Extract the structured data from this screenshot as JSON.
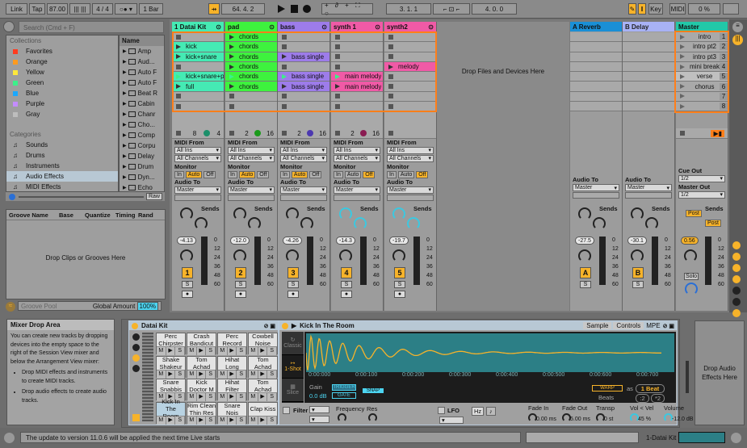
{
  "toolbar": {
    "link": "Link",
    "tap": "Tap",
    "tempo": "87.00",
    "signature": "4 / 4",
    "quantize": "1 Bar",
    "position": "64.  4.  2",
    "loop_start": "3.  1.  1",
    "loop_length": "4.  0.  0",
    "key": "Key",
    "midi": "MIDI",
    "cpu": "0 %"
  },
  "browser": {
    "search_placeholder": "Search (Cmd + F)",
    "collections_label": "Collections",
    "collections": [
      {
        "label": "Favorites",
        "color": "#ff3b1f"
      },
      {
        "label": "Orange",
        "color": "#ff9a1f"
      },
      {
        "label": "Yellow",
        "color": "#ffe83a"
      },
      {
        "label": "Green",
        "color": "#3cf08a"
      },
      {
        "label": "Blue",
        "color": "#1aa8ff"
      },
      {
        "label": "Purple",
        "color": "#c48cff"
      },
      {
        "label": "Gray",
        "color": "#bdbdbd"
      }
    ],
    "categories_label": "Categories",
    "categories": [
      {
        "label": "Sounds",
        "icon": "note-icon"
      },
      {
        "label": "Drums",
        "icon": "drums-icon"
      },
      {
        "label": "Instruments",
        "icon": "instrument-icon"
      },
      {
        "label": "Audio Effects",
        "icon": "audio-effects-icon",
        "selected": true
      },
      {
        "label": "MIDI Effects",
        "icon": "midi-effects-icon"
      }
    ],
    "name_header": "Name",
    "items": [
      "Amp",
      "Aud...",
      "Auto F",
      "Auto F",
      "Beat R",
      "Cabin",
      "Chanr",
      "Cho...",
      "Comp",
      "Corpu",
      "Delay",
      "Drum",
      "Dyn...",
      "Echo"
    ],
    "raw": "Raw"
  },
  "groove": {
    "columns": [
      "Groove Name",
      "Base",
      "Quantize",
      "Timing",
      "Rand"
    ],
    "empty": "Drop Clips or Grooves Here",
    "title": "Groove Pool",
    "global_amount_label": "Global Amount",
    "global_amount": "100%"
  },
  "tracks": [
    {
      "name": "1 Datai Kit",
      "color": "#45eab4",
      "clips": [
        "",
        "kick",
        "kick+snare",
        "",
        "kick+snare+pe",
        "full",
        "",
        ""
      ],
      "playing": 4,
      "stop_a": "8",
      "stop_b": "4",
      "dot": "#1c8f6a",
      "midi_from": "All Ins",
      "channels": "All Channels",
      "monitor": "Auto",
      "audio_to": "Master",
      "volume": "-4.13",
      "number": "1"
    },
    {
      "name": "pad",
      "color": "#3ef23e",
      "clips": [
        "chords",
        "chords",
        "chords",
        "chords",
        "chords",
        "chords",
        "",
        ""
      ],
      "playing": 4,
      "stop_a": "2",
      "stop_b": "16",
      "dot": "#1a9a1a",
      "midi_from": "All Ins",
      "channels": "All Channels",
      "monitor": "Auto",
      "audio_to": "Master",
      "volume": "-12.0",
      "number": "2"
    },
    {
      "name": "bass",
      "color": "#9d7cea",
      "clips": [
        "",
        "",
        "bass single",
        "",
        "bass single",
        "bass single",
        "",
        ""
      ],
      "playing": 4,
      "stop_a": "2",
      "stop_b": "16",
      "dot": "#4c38b0",
      "midi_from": "All Ins",
      "channels": "All Channels",
      "monitor": "Auto",
      "audio_to": "Master",
      "volume": "-4.26",
      "number": "3"
    },
    {
      "name": "synth 1",
      "color": "#f05aa6",
      "clips": [
        "",
        "",
        "",
        "",
        "main melody",
        "main melody",
        "",
        ""
      ],
      "playing": 4,
      "stop_a": "2",
      "stop_b": "16",
      "dot": "#8a1c52",
      "midi_from": "All Ins",
      "channels": "All Channels",
      "monitor": "Off",
      "audio_to": "Master",
      "volume": "-14.3",
      "number": "4"
    },
    {
      "name": "synth2",
      "color": "#f05aa6",
      "clips": [
        "",
        "",
        "",
        "melody",
        "",
        "",
        "",
        ""
      ],
      "playing": -1,
      "stop_a": "",
      "stop_b": "",
      "dot": "",
      "midi_from": "All Ins",
      "channels": "All Channels",
      "monitor": "Off",
      "audio_to": "Master",
      "volume": "-19.7",
      "number": "5"
    }
  ],
  "drop_area": "Drop Files and Devices Here",
  "returns": [
    {
      "name": "A Reverb",
      "color": "#1a8fd6",
      "audio_to": "Master",
      "volume": "-27.5",
      "letter": "A"
    },
    {
      "name": "B Delay",
      "color": "#a8b2f5",
      "audio_to": "Master",
      "volume": "-30.1",
      "letter": "B"
    }
  ],
  "master": {
    "name": "Master",
    "color": "#22c8a8",
    "scenes": [
      "intro",
      "intro pt2",
      "intro pt3",
      "mini break",
      "verse",
      "chorus",
      "",
      ""
    ],
    "cue_out_label": "Cue Out",
    "cue_out": "1/2",
    "master_out_label": "Master Out",
    "master_out": "1/2",
    "post": "Post",
    "volume": "0.56",
    "solo": "Solo"
  },
  "mixer_labels": {
    "midi_from": "MIDI From",
    "monitor": "Monitor",
    "audio_to": "Audio To",
    "sends": "Sends",
    "in": "In",
    "auto": "Auto",
    "off": "Off",
    "solo": "S",
    "scale": [
      "0",
      "12",
      "24",
      "36",
      "48",
      "60"
    ]
  },
  "info": {
    "title": "Mixer Drop Area",
    "body": "You can create new tracks by dropping devices into the empty space to the right of the Session View mixer and below the Arrangement View mixer:",
    "bullets": [
      "Drop MIDI effects and instruments to create MIDI tracks.",
      "Drop audio effects to create audio tracks."
    ]
  },
  "drum_rack": {
    "title": "Datai Kit",
    "pads": [
      "Perc Chirpster",
      "Crash Bandicut",
      "Perc Record",
      "Cowbell Noise",
      "Shake Shakeur",
      "Tom Achad",
      "Hihat Long",
      "Tom Achad",
      "Snare Snabbis",
      "Kick Doctor M",
      "Hihat Filter",
      "Tom Achad",
      "Kick In The Room",
      "Rim Clean Thin Res",
      "Snare Nois",
      "Clap Kiss"
    ],
    "selected_pad": 12,
    "m": "M",
    "s": "S"
  },
  "simpler": {
    "title": "Kick In The Room",
    "tabs": [
      "Sample",
      "Controls"
    ],
    "mpe": "MPE",
    "modes": [
      "Classic",
      "1-Shot",
      "Slice"
    ],
    "active_mode": 1,
    "timeline": [
      "0:00:000",
      "0:00:100",
      "0:00:200",
      "0:00:300",
      "0:00:400",
      "0:00:500",
      "0:00:600",
      "0:00:700"
    ],
    "gain_label": "Gain",
    "gain": "0.0 dB",
    "trigger": "TRIGGER",
    "gate": "GATE",
    "snap": "SNAP",
    "warp": "WARP",
    "as": "as",
    "beats_value": "1 Beat",
    "beats": "Beats",
    "half": ":2",
    "double": "*2",
    "filter": "Filter",
    "frequency": "Frequency",
    "res": "Res",
    "lfo": "LFO",
    "hz": "Hz",
    "params": [
      {
        "label": "Fade In",
        "value": "0.00 ms"
      },
      {
        "label": "Fade Out",
        "value": "5.00 ms"
      },
      {
        "label": "Transp",
        "value": "0 st"
      },
      {
        "label": "Vol < Vel",
        "value": "45 %"
      },
      {
        "label": "Volume",
        "value": "-12.0 dB"
      }
    ],
    "waveform_color": "#f7b32a",
    "display_color": "#2c7f86"
  },
  "drop_audio_effects": "Drop Audio Effects Here",
  "status": {
    "message": "The update to version 11.0.6 will be applied the next time Live starts",
    "track": "1-Datai Kit"
  }
}
